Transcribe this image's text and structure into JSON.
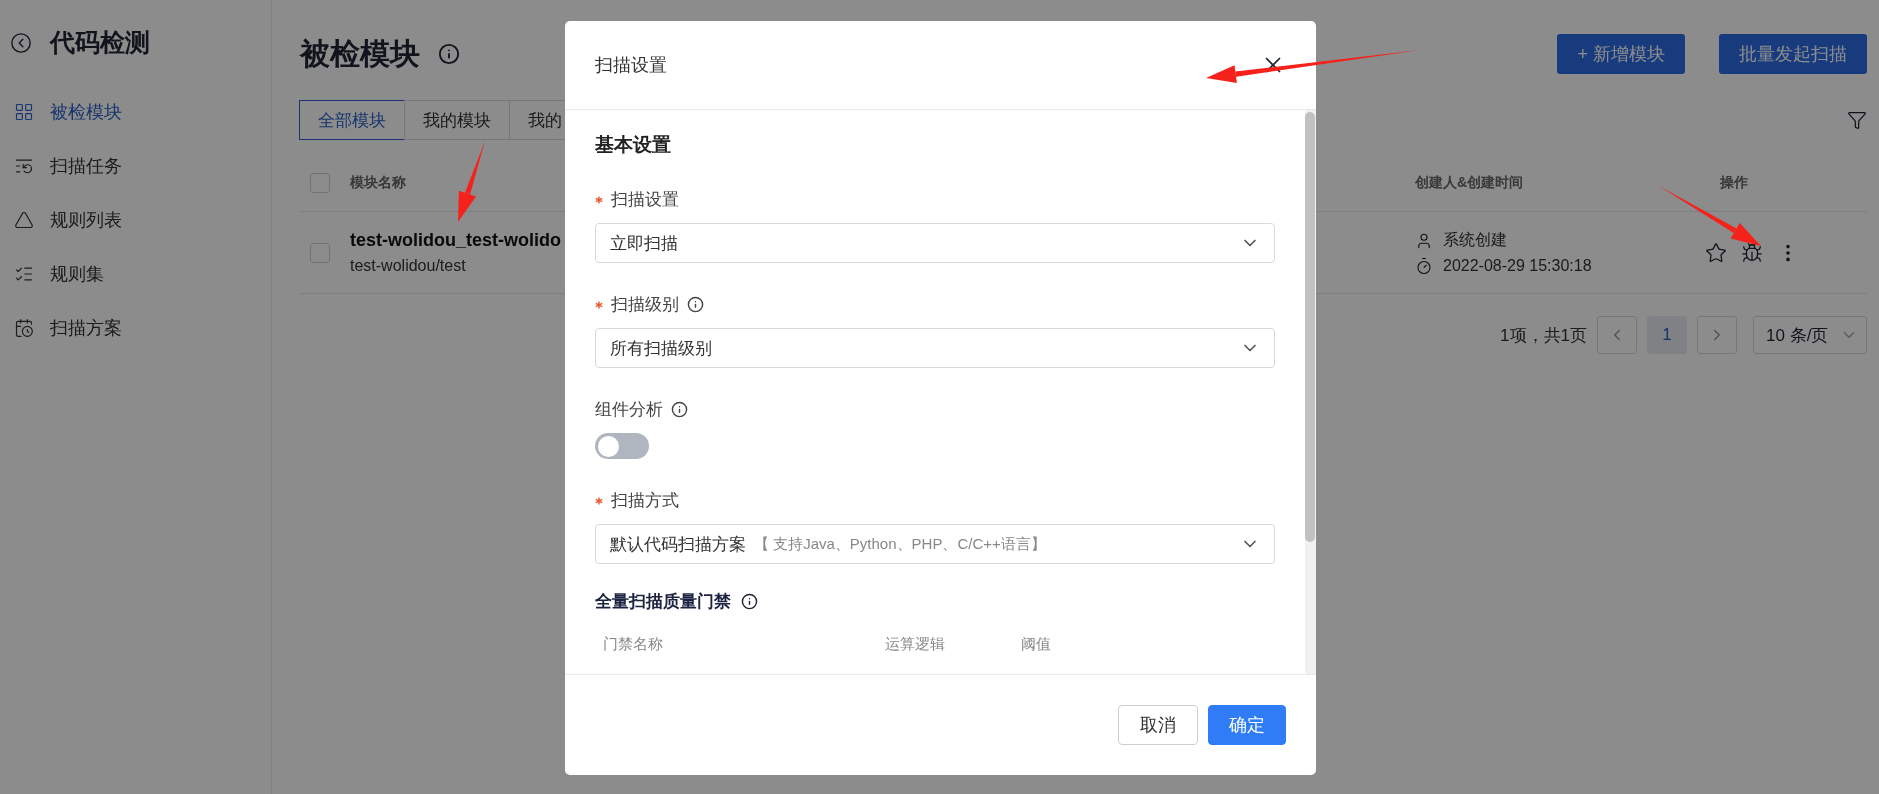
{
  "sidebar": {
    "title": "代码检测",
    "items": [
      {
        "label": "被检模块",
        "selected": true
      },
      {
        "label": "扫描任务",
        "selected": false
      },
      {
        "label": "规则列表",
        "selected": false
      },
      {
        "label": "规则集",
        "selected": false
      },
      {
        "label": "扫描方案",
        "selected": false
      }
    ]
  },
  "page": {
    "title": "被检模块",
    "buttons": [
      "+ 新增模块",
      "批量发起扫描"
    ]
  },
  "tabs": [
    {
      "label": "全部模块",
      "selected": true
    },
    {
      "label": "我的模块",
      "selected": false
    },
    {
      "label": "我的",
      "selected": false
    }
  ],
  "table": {
    "all_checked": false,
    "columns": [
      "模块名称",
      "创建人&创建时间",
      "操作"
    ],
    "rows": [
      {
        "name": "test-wolidou_test-wolido",
        "path": "test-wolidou/test",
        "creator": "系统创建",
        "created_at": "2022-08-29 15:30:18",
        "starred": false,
        "checked": false
      }
    ]
  },
  "pagination": {
    "summary": "1项，共1页",
    "pages": [
      {
        "label": "1",
        "selected": true
      }
    ],
    "page_size": "10 条/页"
  },
  "dialog": {
    "title": "扫描设置",
    "section_title": "基本设置",
    "fields": [
      {
        "kind": "select",
        "label": "扫描设置",
        "required": true,
        "info": false,
        "value": "立即扫描"
      },
      {
        "kind": "select",
        "label": "扫描级别",
        "required": true,
        "info": true,
        "value": "所有扫描级别"
      },
      {
        "kind": "switch",
        "label": "组件分析",
        "required": false,
        "info": true,
        "on": false
      },
      {
        "kind": "select",
        "label": "扫描方式",
        "required": true,
        "info": false,
        "value": "默认代码扫描方案",
        "hint": "【 支持Java、Python、PHP、C/C++语言】"
      }
    ],
    "gate": {
      "title": "全量扫描质量门禁",
      "columns": [
        "门禁名称",
        "运算逻辑",
        "阈值"
      ]
    },
    "buttons": [
      {
        "label": "取消",
        "kind": "secondary"
      },
      {
        "label": "确定",
        "kind": "primary"
      }
    ]
  }
}
